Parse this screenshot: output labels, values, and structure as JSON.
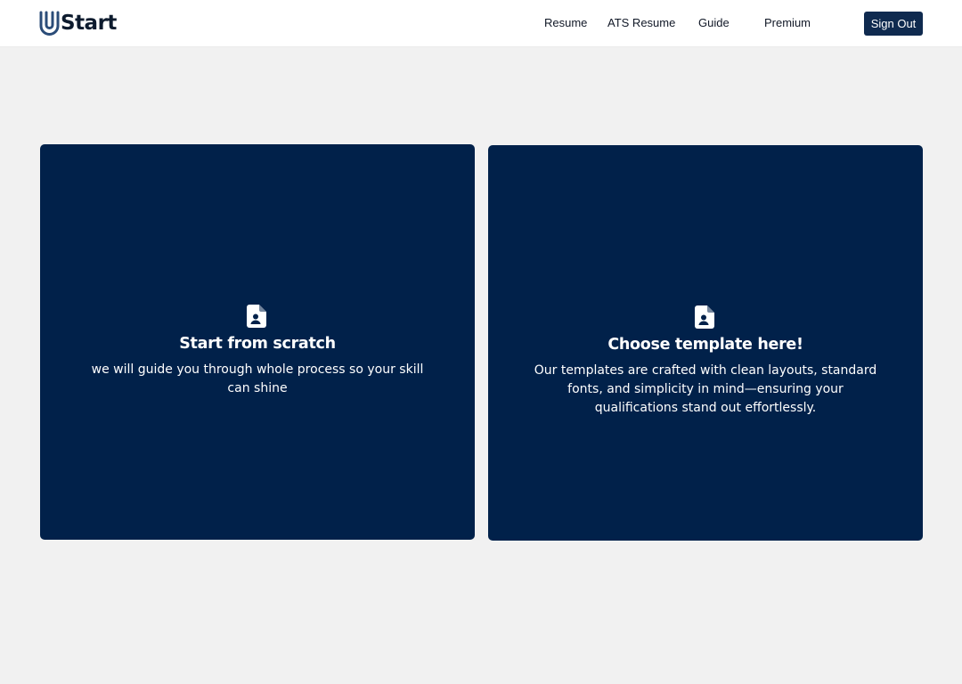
{
  "brand": {
    "name": "Start",
    "logo_icon": "paperclip-u-icon",
    "text_color": "#0d1b2e",
    "mark_color": "#2b4c78"
  },
  "nav": {
    "links": [
      {
        "label": "Resume"
      },
      {
        "label": "ATS Resume"
      },
      {
        "label": "Guide"
      },
      {
        "label": "Premium"
      }
    ],
    "signout_label": "Sign Out",
    "signout_color": "#0f2a4f"
  },
  "cards": [
    {
      "icon": "resume-file-icon",
      "title": "Start from scratch",
      "description": "we will guide you through whole process so your skill can shine"
    },
    {
      "icon": "resume-file-icon",
      "title": "Choose template here!",
      "description": "Our templates are crafted with clean layouts, standard fonts, and simplicity in mind—ensuring your qualifications stand out effortlessly."
    }
  ],
  "colors": {
    "page_background": "#f1f1f1",
    "card_background": "#01214a",
    "card_text": "#ffffff"
  }
}
